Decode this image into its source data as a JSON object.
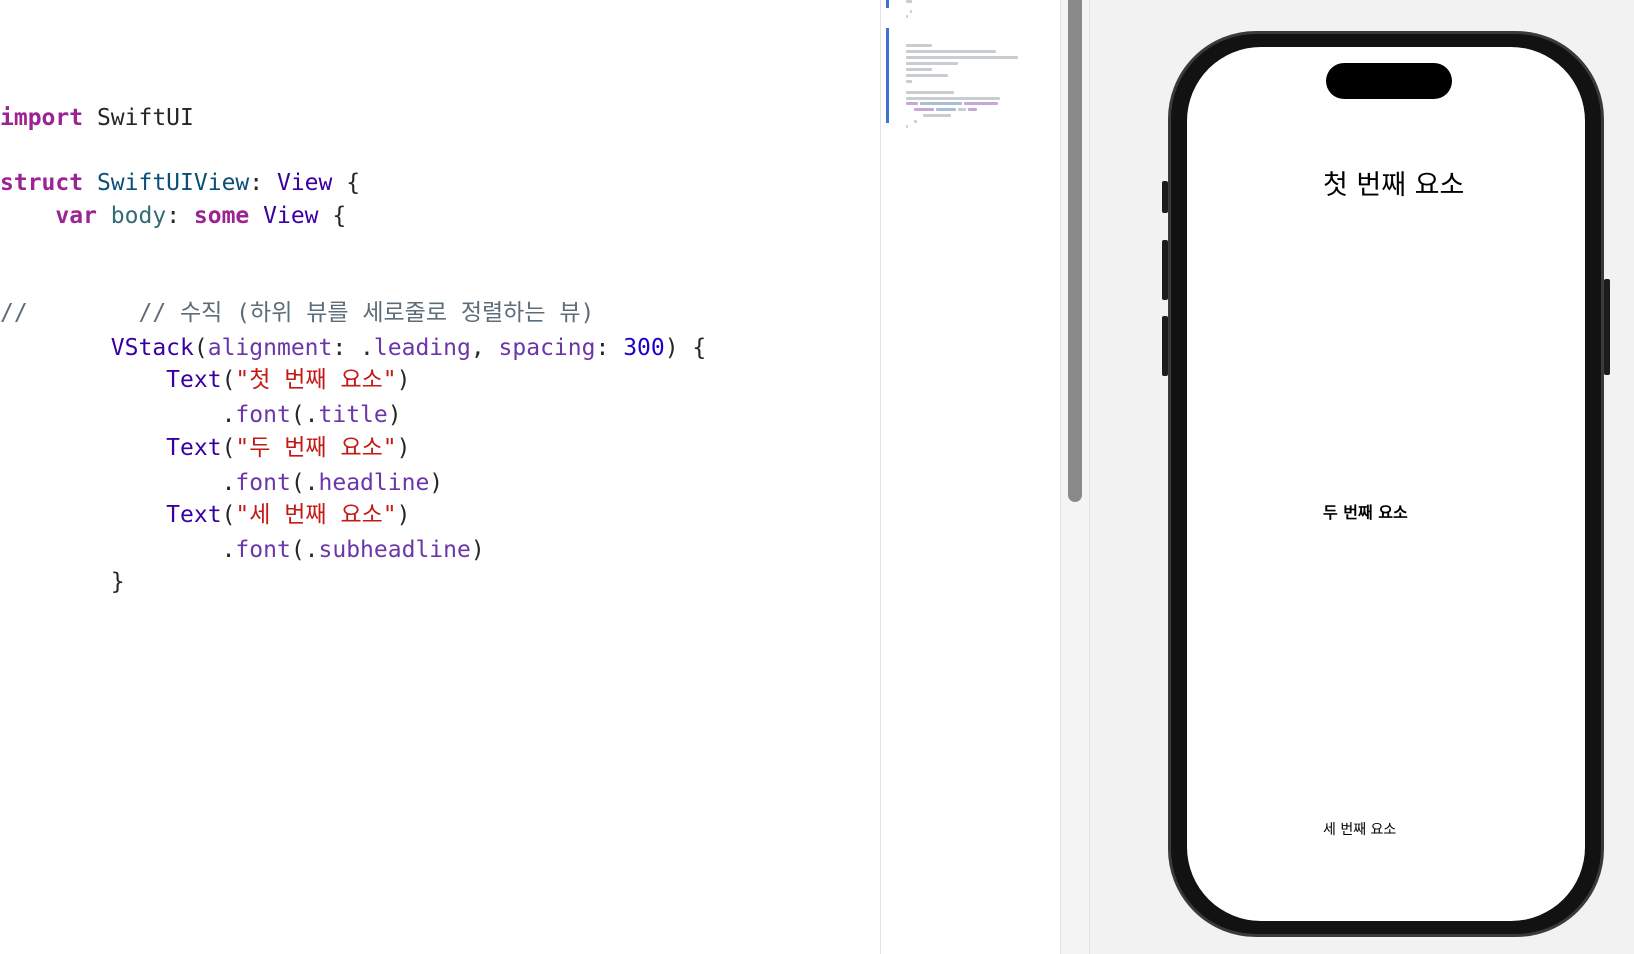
{
  "code": {
    "line1": {
      "kw": "import",
      "rest": " SwiftUI"
    },
    "line2": {
      "kw": "struct",
      "name": " SwiftUIView",
      "colon": ": ",
      "type": "View",
      "brace": " {"
    },
    "line3": {
      "indent": "    ",
      "kw": "var",
      "name": " body",
      "colon": ": ",
      "kw2": "some",
      "type": " View",
      "brace": " {"
    },
    "line4": {
      "comment": "//        // 수직 (하위 뷰를 세로줄로 정렬하는 뷰)"
    },
    "line5": {
      "indent": "        ",
      "fn": "VStack",
      "p1": "(",
      "arg1": "alignment",
      "c1": ": .",
      "val1": "leading",
      "p2": ", ",
      "arg2": "spacing",
      "c2": ": ",
      "num": "300",
      "end": ") {"
    },
    "line6": {
      "indent": "            ",
      "fn": "Text",
      "open": "(",
      "str": "\"첫 번째 요소\"",
      "close": ")"
    },
    "line7": {
      "indent": "                ",
      "dot": ".",
      "mod": "font",
      "open": "(.",
      "arg": "title",
      "close": ")"
    },
    "line8": {
      "indent": "            ",
      "fn": "Text",
      "open": "(",
      "str": "\"두 번째 요소\"",
      "close": ")"
    },
    "line9": {
      "indent": "                ",
      "dot": ".",
      "mod": "font",
      "open": "(.",
      "arg": "headline",
      "close": ")"
    },
    "line10": {
      "indent": "            ",
      "fn": "Text",
      "open": "(",
      "str": "\"세 번째 요소\"",
      "close": ")"
    },
    "line11": {
      "indent": "                ",
      "dot": ".",
      "mod": "font",
      "open": "(.",
      "arg": "subheadline",
      "close": ")"
    },
    "line12": {
      "indent": "        ",
      "brace": "}"
    }
  },
  "preview": {
    "title_text": "첫 번째 요소",
    "headline_text": "두 번째 요소",
    "subheadline_text": "세 번째 요소"
  }
}
